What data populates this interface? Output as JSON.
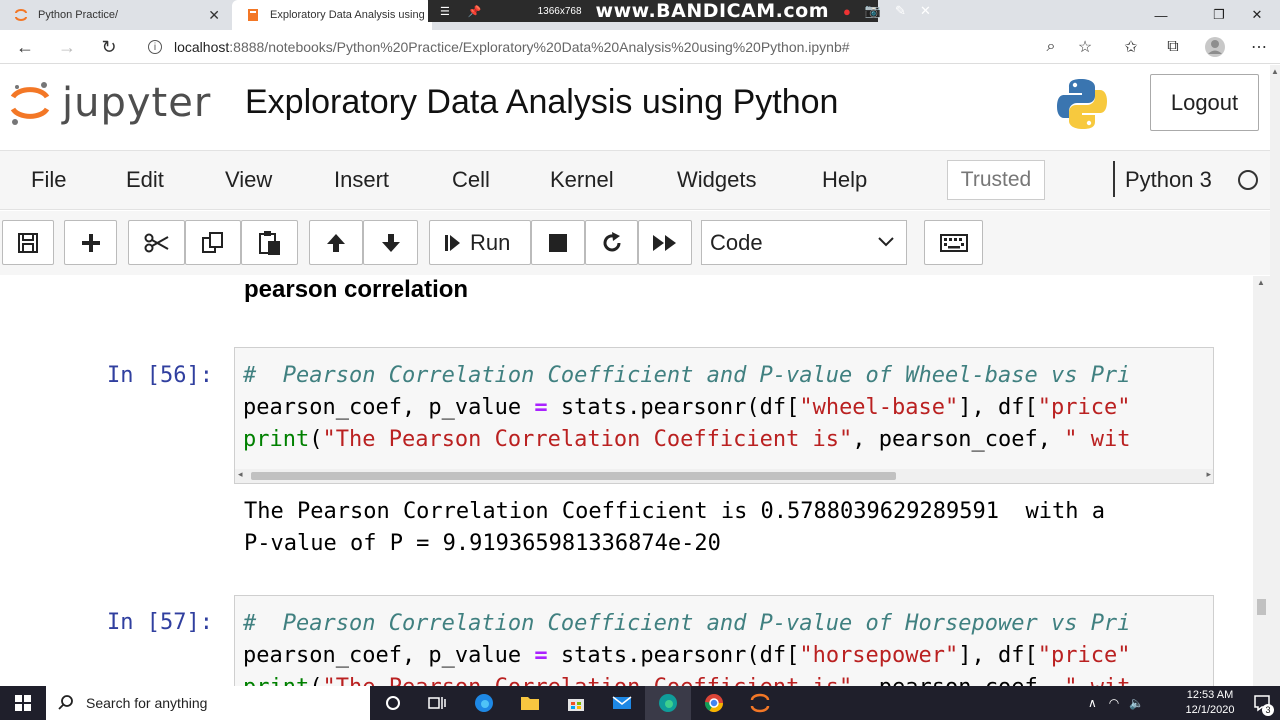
{
  "browser": {
    "tabs": [
      {
        "title": "Python Practice/"
      },
      {
        "title": "Exploratory Data Analysis using"
      }
    ],
    "url_host": "localhost",
    "url_rest": ":8888/notebooks/Python%20Practice/Exploratory%20Data%20Analysis%20using%20Python.ipynb#"
  },
  "recorder": {
    "resolution": "1366x768",
    "brand": "www.BANDICAM.com"
  },
  "header": {
    "logo_text": "jupyter",
    "notebook_title": "Exploratory Data Analysis using Python",
    "logout_label": "Logout"
  },
  "menubar": {
    "items": [
      "File",
      "Edit",
      "View",
      "Insert",
      "Cell",
      "Kernel",
      "Widgets",
      "Help"
    ],
    "trusted_label": "Trusted",
    "kernel_name": "Python 3"
  },
  "toolbar": {
    "run_label": "Run",
    "cell_type": "Code"
  },
  "notebook": {
    "markdown_heading": "pearson correlation",
    "cell56": {
      "prompt": "In [56]:",
      "line1": "#  Pearson Correlation Coefficient and P-value of Wheel-base vs Pri",
      "line2_a": "pearson_coef, p_value ",
      "line2_op": "=",
      "line2_b": " stats.pearsonr(df[",
      "line2_s1": "\"wheel-base\"",
      "line2_c": "], df[",
      "line2_s2": "\"price\"",
      "line3_kw": "print",
      "line3_a": "(",
      "line3_s1": "\"The Pearson Correlation Coefficient is\"",
      "line3_b": ", pearson_coef, ",
      "line3_s2": "\" wit",
      "output_line1": "The Pearson Correlation Coefficient is 0.5788039629289591  with a",
      "output_line2": "P-value of P = 9.919365981336874e-20"
    },
    "cell57": {
      "prompt": "In [57]:",
      "line1": "#  Pearson Correlation Coefficient and P-value of Horsepower vs Pri",
      "line2_a": "pearson_coef, p_value ",
      "line2_op": "=",
      "line2_b": " stats.pearsonr(df[",
      "line2_s1": "\"horsepower\"",
      "line2_c": "], df[",
      "line2_s2": "\"price\"",
      "line3_kw": "print",
      "line3_a": "(",
      "line3_s1": "\"The Pearson Correlation Coefficient is\"",
      "line3_b": ", pearson_coef, ",
      "line3_s2": "\" wit"
    }
  },
  "taskbar": {
    "search_placeholder": "Search for anything",
    "time": "12:53 AM",
    "date": "12/1/2020",
    "notification_count": "3"
  },
  "colors": {
    "prompt": "#303f9f",
    "comment": "#408080",
    "string": "#ba2121",
    "operator": "#aa22ff",
    "keyword": "#008000",
    "jupyter_orange": "#f37726"
  }
}
